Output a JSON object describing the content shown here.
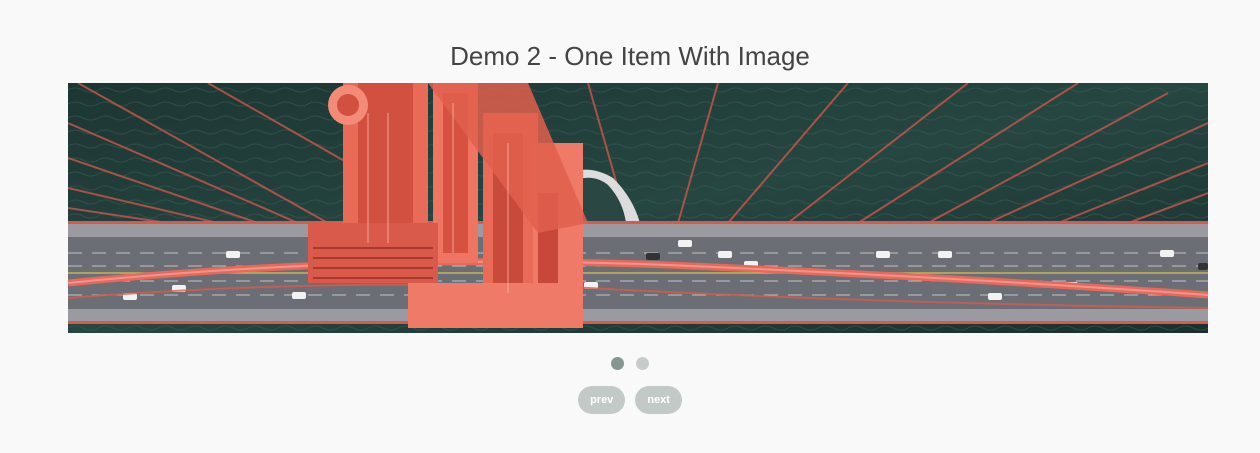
{
  "title": "Demo 2 - One Item With Image",
  "carousel": {
    "slides": 2,
    "active_slide": 1,
    "image_subject": "aerial-bridge-tower-photo"
  },
  "dots": [
    {
      "label": "slide-1",
      "active": true
    },
    {
      "label": "slide-2",
      "active": false
    }
  ],
  "nav": {
    "prev_label": "prev",
    "next_label": "next"
  },
  "colors": {
    "background": "#f9f9f9",
    "title": "#444444",
    "dot_active": "#869791",
    "dot_inactive": "#c8ccc9",
    "button_bg": "#c3c9c6",
    "button_text": "#ffffff",
    "water": "#1f3a37",
    "bridge_red": "#e8584a",
    "road": "#5a5d66"
  }
}
